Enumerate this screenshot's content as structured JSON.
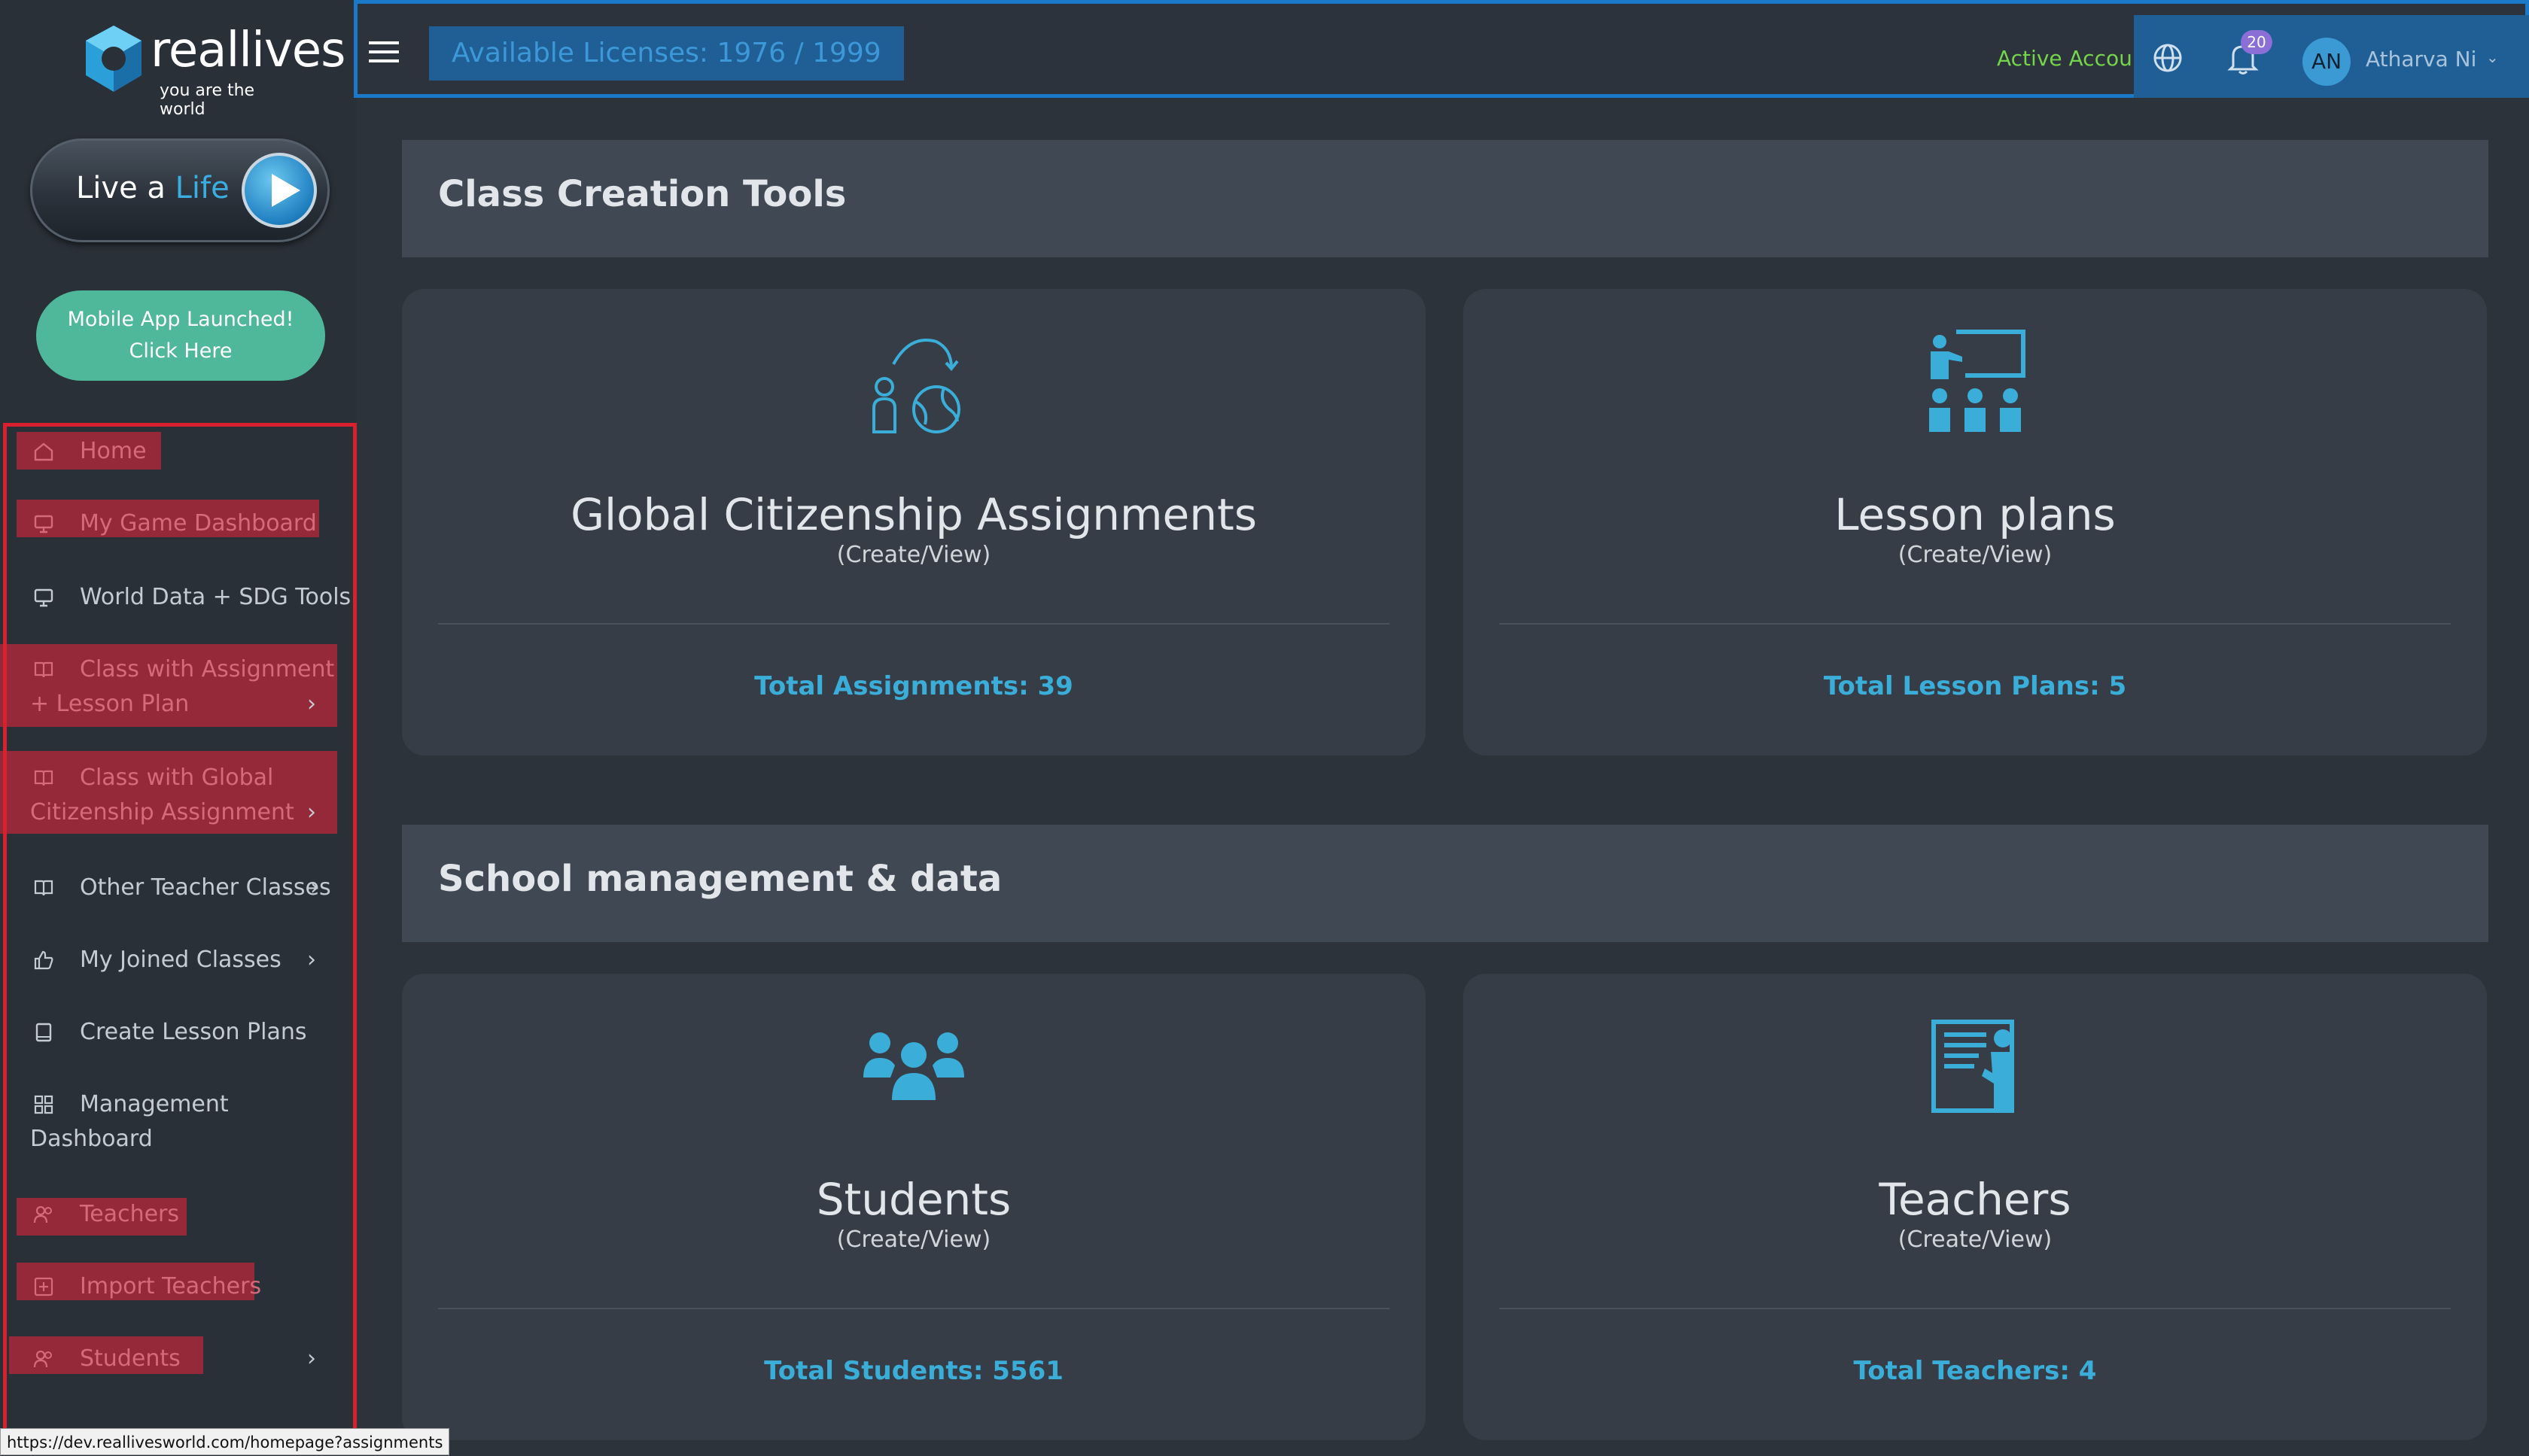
{
  "logo": {
    "brand": "reallives",
    "tagline": "you are the world"
  },
  "live_button": {
    "part1": "Live a ",
    "part2": "Life"
  },
  "mobile_button": {
    "line1": "Mobile App Launched!",
    "line2": "Click Here"
  },
  "sidebar": {
    "items": [
      {
        "label": "Home",
        "icon": "home-icon"
      },
      {
        "label": "My Game Dashboard",
        "icon": "monitor-icon"
      },
      {
        "label": "World Data + SDG Tools",
        "icon": "monitor-icon"
      },
      {
        "label": "Class with Assignment",
        "label2": "+ Lesson Plan",
        "icon": "book-icon"
      },
      {
        "label": "Class with Global",
        "label2": "Citizenship Assignment",
        "icon": "book-icon"
      },
      {
        "label": "Other Teacher Classes",
        "icon": "book-icon"
      },
      {
        "label": "My Joined Classes",
        "icon": "thumbs-up-icon"
      },
      {
        "label": "Create Lesson Plans",
        "icon": "notebook-icon"
      },
      {
        "label": "Management",
        "label2": "Dashboard",
        "icon": "grid-icon"
      },
      {
        "label": "Teachers",
        "icon": "users-icon"
      },
      {
        "label": "Import Teachers",
        "icon": "plus-square-icon"
      },
      {
        "label": "Students",
        "icon": "users-icon"
      }
    ]
  },
  "topbar": {
    "licenses": "Available Licenses: 1976 / 1999",
    "active_account": "Active Account",
    "notifications_count": "20",
    "avatar_initials": "AN",
    "user_name": "Atharva Ni"
  },
  "sections": [
    {
      "title": "Class Creation Tools",
      "cards": [
        {
          "title": "Global Citizenship Assignments",
          "subtitle": "(Create/View)",
          "total": "Total Assignments: 39",
          "icon": "global-citizen-icon"
        },
        {
          "title": "Lesson plans",
          "subtitle": "(Create/View)",
          "total": "Total Lesson Plans: 5",
          "icon": "classroom-icon"
        }
      ]
    },
    {
      "title": "School management & data",
      "cards": [
        {
          "title": "Students",
          "subtitle": "(Create/View)",
          "total": "Total Students: 5561",
          "icon": "students-group-icon"
        },
        {
          "title": "Teachers",
          "subtitle": "(Create/View)",
          "total": "Total Teachers: 4",
          "icon": "teacher-board-icon"
        }
      ]
    }
  ],
  "status_bar": {
    "url": "https://dev.reallivesworld.com/homepage?assignments"
  },
  "colors": {
    "accent": "#3aaed8",
    "highlight_red": "#a8283a",
    "topbar_border": "#1a79c9",
    "active_green": "#74d44a",
    "mobile_btn": "#4fb89a"
  }
}
